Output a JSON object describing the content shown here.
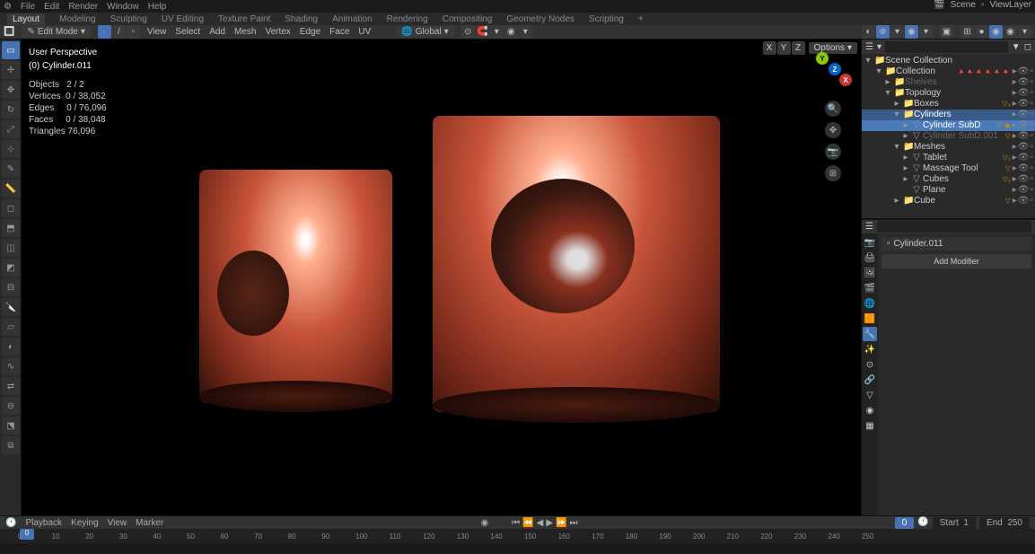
{
  "top_menu": {
    "items": [
      "File",
      "Edit",
      "Render",
      "Window",
      "Help"
    ]
  },
  "workspace_tabs": {
    "items": [
      "Layout",
      "Modeling",
      "Sculpting",
      "UV Editing",
      "Texture Paint",
      "Shading",
      "Animation",
      "Rendering",
      "Compositing",
      "Geometry Nodes",
      "Scripting"
    ],
    "add": "+"
  },
  "scene": {
    "label": "Scene",
    "layer": "ViewLayer"
  },
  "header": {
    "mode": "Edit Mode",
    "menus": [
      "View",
      "Select",
      "Add",
      "Mesh",
      "Vertex",
      "Edge",
      "Face",
      "UV"
    ],
    "orientation": "Global",
    "options": "Options"
  },
  "viewport_top_right": {
    "xyz": [
      "X",
      "Y",
      "Z"
    ]
  },
  "stats": {
    "title1": "User Perspective",
    "title2": "(0) Cylinder.011",
    "objects_l": "Objects",
    "objects_v": "2 / 2",
    "vertices_l": "Vertices",
    "vertices_v": "0 / 38,052",
    "edges_l": "Edges",
    "edges_v": "0 / 76,096",
    "faces_l": "Faces",
    "faces_v": "0 / 38,048",
    "tris_l": "Triangles",
    "tris_v": "76,096"
  },
  "outliner": {
    "root": "Scene Collection",
    "items": [
      {
        "ind": 1,
        "ico": "▾",
        "name": "Collection",
        "dim": false,
        "sel": false,
        "right": "🔺🔺🔺🔺🔺🔺"
      },
      {
        "ind": 2,
        "ico": "▸",
        "name": "Shelves",
        "dim": true,
        "sel": false
      },
      {
        "ind": 2,
        "ico": "▾",
        "name": "Topology",
        "dim": false,
        "sel": false
      },
      {
        "ind": 3,
        "ico": "▸",
        "name": "Boxes",
        "dim": false,
        "sel": false,
        "right": "▽₃"
      },
      {
        "ind": 3,
        "ico": "▾",
        "name": "Cylinders",
        "dim": false,
        "sel": true
      },
      {
        "ind": 4,
        "ico": "▸",
        "name": "Cylinder SubD",
        "dim": false,
        "sel2": true,
        "right": "▽ ◉"
      },
      {
        "ind": 4,
        "ico": "▸",
        "name": "Cylinder SubD.001",
        "dim": true,
        "sel": false,
        "right": "▽"
      },
      {
        "ind": 3,
        "ico": "▾",
        "name": "Meshes",
        "dim": false,
        "sel": false
      },
      {
        "ind": 4,
        "ico": "▸",
        "name": "Tablet",
        "dim": false,
        "sel": false,
        "right": "▽₂"
      },
      {
        "ind": 4,
        "ico": "▸",
        "name": "Massage Tool",
        "dim": false,
        "sel": false,
        "right": "▽"
      },
      {
        "ind": 4,
        "ico": "▸",
        "name": "Cubes",
        "dim": false,
        "sel": false,
        "right": "▽₂"
      },
      {
        "ind": 4,
        "ico": "",
        "name": "Plane",
        "dim": false,
        "sel": false
      },
      {
        "ind": 3,
        "ico": "▸",
        "name": "Cube",
        "dim": false,
        "sel": false,
        "right": "▽"
      }
    ]
  },
  "properties": {
    "object": "Cylinder.011",
    "add_modifier": "Add Modifier"
  },
  "timeline": {
    "menus": [
      "Playback",
      "Keying",
      "View",
      "Marker"
    ],
    "current": "0",
    "start_l": "Start",
    "start_v": "1",
    "end_l": "End",
    "end_v": "250",
    "ticks": [
      0,
      10,
      20,
      30,
      40,
      50,
      60,
      70,
      80,
      90,
      100,
      110,
      120,
      130,
      140,
      150,
      160,
      170,
      180,
      190,
      200,
      210,
      220,
      230,
      240,
      250
    ],
    "cursor": "0"
  },
  "search_placeholder": ""
}
